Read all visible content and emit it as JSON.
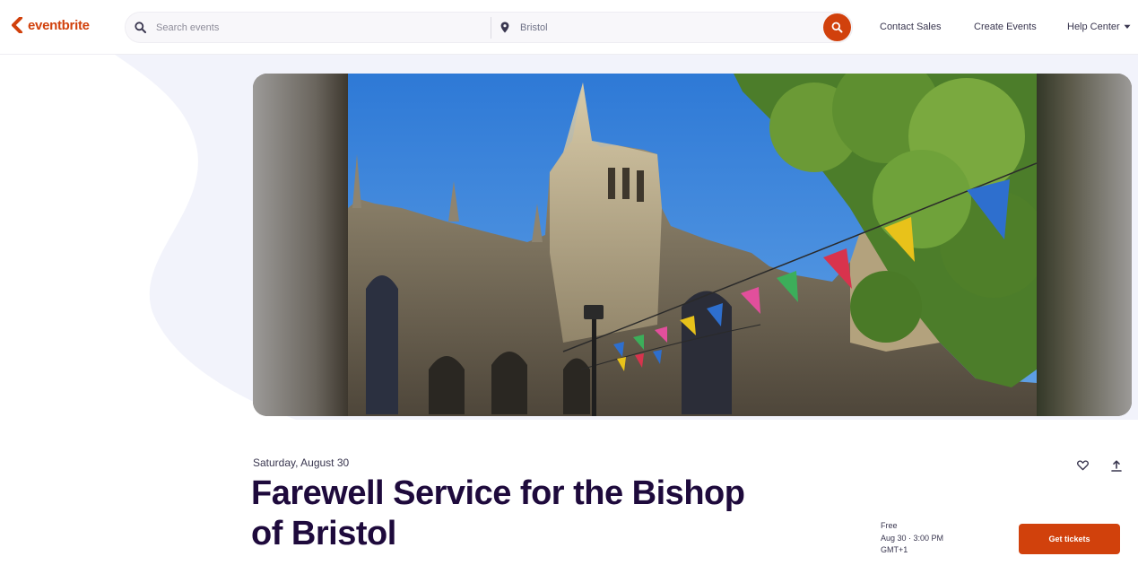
{
  "brand": {
    "name": "eventbrite",
    "color": "#d1410c"
  },
  "header": {
    "search_placeholder": "Search events",
    "location_value": "Bristol",
    "nav": {
      "contact_sales": "Contact Sales",
      "create_events": "Create Events",
      "help_center": "Help Center"
    }
  },
  "event": {
    "date": "Saturday, August 30",
    "title": "Farewell Service for the Bishop of Bristol",
    "ticket": {
      "price": "Free",
      "time_line1": "Aug 30 · 3:00 PM",
      "time_line2": "GMT+1",
      "button_label": "Get tickets"
    }
  },
  "icons": {
    "search": "search-icon",
    "location": "map-pin-icon",
    "dropdown": "chevron-down-icon",
    "like": "heart-icon",
    "share": "share-icon"
  },
  "colors": {
    "accent": "#d1410c",
    "heading": "#1e0a3c",
    "text": "#39364f"
  }
}
